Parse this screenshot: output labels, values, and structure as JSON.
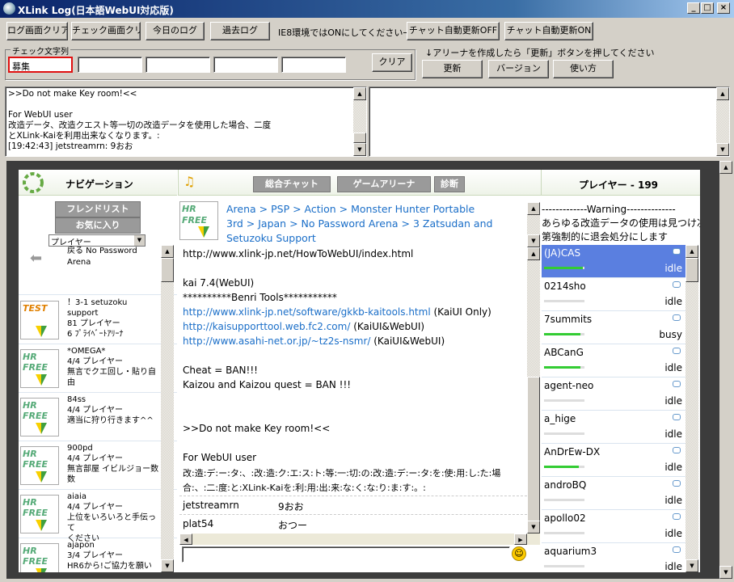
{
  "window": {
    "title": "XLink Log(日本語WebUI対応版)",
    "min": "_",
    "max": "□",
    "close": "×"
  },
  "toolbar": {
    "clear_log": "ログ画面クリア",
    "clear_check": "チェック画面クリア",
    "today_log": "今日のログ",
    "past_log": "過去ログ",
    "ie8_note": "IE8環境ではONにしてください→",
    "auto_off": "チャット自動更新OFF",
    "auto_on": "チャット自動更新ON"
  },
  "check": {
    "legend": "チェック文字列",
    "fields": [
      "募集",
      "",
      "",
      "",
      "",
      ""
    ],
    "clear": "クリア"
  },
  "arena": {
    "note": "↓アリーナを作成したら「更新」ボタンを押してください",
    "update": "更新",
    "version": "バージョン",
    "howto": "使い方"
  },
  "log": {
    "lines": [
      ">>Do not make Key room!<<",
      "",
      "For WebUI user",
      "改造データ、改造クエスト等一切の改造データを使用した場合、二度",
      "とXLink-Kaiを利用出来なくなります。:",
      "[19:42:43] jetstreamrn: 9おお"
    ]
  },
  "nav": {
    "title": "ナビゲーション",
    "friend_list": "フレンドリスト",
    "favorites": "お気に入り",
    "select": "プレイヤー",
    "back_text": "戻る No Password Arena",
    "items": [
      {
        "badge": "TEST",
        "l1": "！3-1 setuzoku",
        "l2": "support",
        "l3": "81 プレイヤー",
        "l4": "6 ﾌﾟﾗｲﾍﾞｰﾄｱﾘｰﾅ"
      },
      {
        "badge": "HR FREE",
        "l1": "*OMEGA*",
        "l2": "4/4 プレイヤー",
        "l3": "無言でクエ回し・貼り自由",
        "l4": ""
      },
      {
        "badge": "HR FREE",
        "l1": "84ss",
        "l2": "4/4 プレイヤー",
        "l3": "適当に狩り行きます^^",
        "l4": ""
      },
      {
        "badge": "HR FREE",
        "l1": "900pd",
        "l2": "4/4 プレイヤー",
        "l3": "無言部屋 イビルジョー数",
        "l4": "数"
      },
      {
        "badge": "HR FREE",
        "l1": "aiaia",
        "l2": "4/4 プレイヤー",
        "l3": "上位をいろいろと手伝って",
        "l4": "ください"
      },
      {
        "badge": "HR FREE",
        "l1": "ajapon",
        "l2": "3/4 プレイヤー",
        "l3": "HR6から!ご協力を願い",
        "l4": ""
      }
    ]
  },
  "tabs": {
    "chat": "総合チャット",
    "arena": "ゲームアリーナ",
    "diag": "診断"
  },
  "breadcrumb": {
    "l1": "Arena > PSP > Action > Monster Hunter Portable",
    "l2": "3rd > Japan > No Password Arena > 3 Zatsudan and",
    "l3": "Setuzoku Support"
  },
  "chat": {
    "link1": "http://www.xlink-jp.net/HowToWebUI/index.html",
    "kai": "kai 7.4(WebUI)",
    "stars": "**********Benri Tools***********",
    "link2": "http://www.xlink-jp.net/software/gkkb-kaitools.html",
    "suf2": " (KaiUI Only)",
    "link3": "http://kaisupporttool.web.fc2.com/",
    "suf3": " (KaiUI&WebUI)",
    "link4": "http://www.asahi-net.or.jp/~tz2s-nsmr/",
    "suf4": " (KaiUI&WebUI)",
    "cheat": "Cheat = BAN!!!",
    "kaizou": "Kaizou and Kaizou quest = BAN !!!",
    "dnm": ">>Do not make Key room!<<",
    "fwu": "For WebUI user",
    "jp1": "改:造:デ:ー:タ:、:改:造:ク:エ:ス:ト:等:一:切:の:改:造:デ:ー:タ:を:使:用:し:た:場",
    "jp2": "合:、:二:度:と:XLink-Kaiを:利:用:出:来:な:く:な:り:ま:す:。:",
    "msgs": [
      {
        "user": "jetstreamrn",
        "text": "9おお"
      },
      {
        "user": "plat54",
        "text": "おつー"
      }
    ],
    "input": ""
  },
  "players": {
    "title": "プレイヤー - 199",
    "warning1": "-------------Warning--------------",
    "warning2": "あらゆる改造データの使用は見つけ次",
    "warning3": "第強制的に退会処分にします",
    "list": [
      {
        "name": "(JA)CAS",
        "status": "idle",
        "bar": 0.95
      },
      {
        "name": "0214sho",
        "status": "idle",
        "bar": 0
      },
      {
        "name": "7summits",
        "status": "busy",
        "bar": 0.9
      },
      {
        "name": "ABCanG",
        "status": "idle",
        "bar": 0.9
      },
      {
        "name": "agent-neo",
        "status": "idle",
        "bar": 0
      },
      {
        "name": "a_hige",
        "status": "idle",
        "bar": 0
      },
      {
        "name": "AnDrEw-DX",
        "status": "idle",
        "bar": 0.85
      },
      {
        "name": "androBQ",
        "status": "idle",
        "bar": 0
      },
      {
        "name": "apollo02",
        "status": "idle",
        "bar": 0
      },
      {
        "name": "aquarium3",
        "status": "idle",
        "bar": 0
      }
    ]
  }
}
